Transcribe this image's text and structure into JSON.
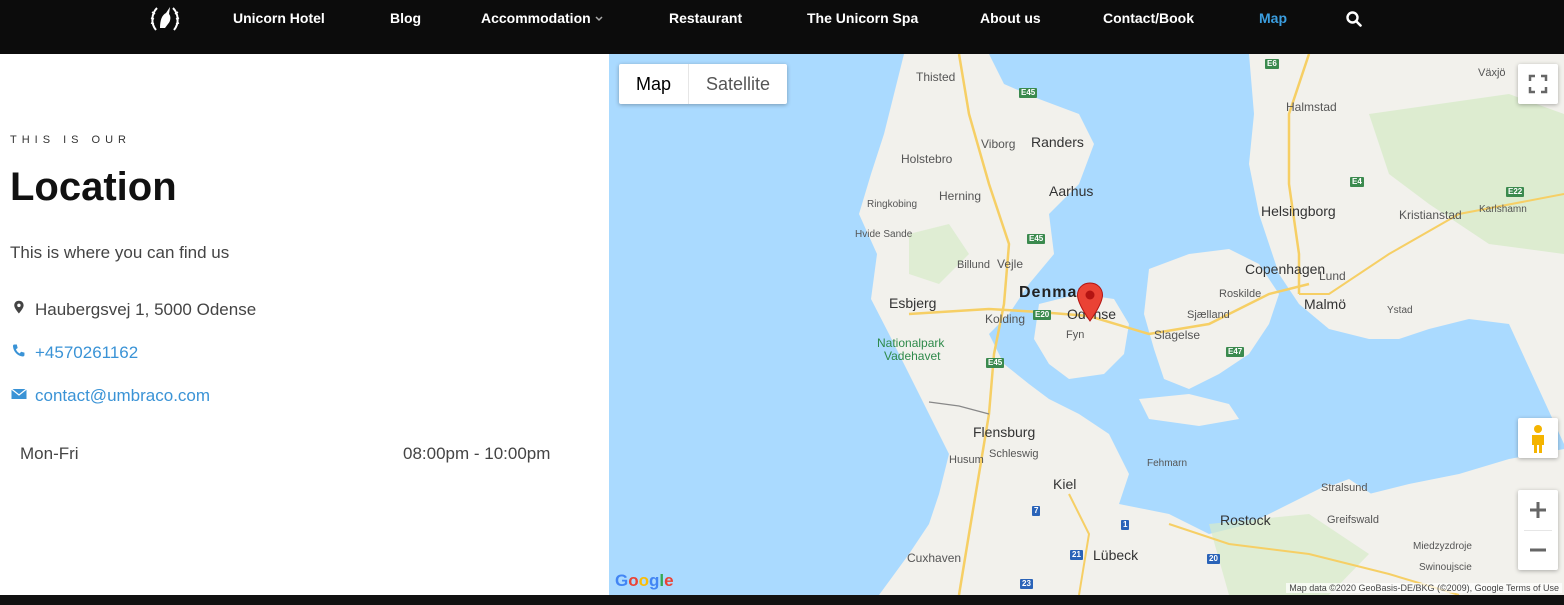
{
  "nav": {
    "items": [
      {
        "label": "Unicorn Hotel",
        "active": false
      },
      {
        "label": "Blog",
        "active": false
      },
      {
        "label": "Accommodation",
        "active": false,
        "has_dropdown": true
      },
      {
        "label": "Restaurant",
        "active": false
      },
      {
        "label": "The Unicorn Spa",
        "active": false
      },
      {
        "label": "About us",
        "active": false
      },
      {
        "label": "Contact/Book",
        "active": false
      },
      {
        "label": "Map",
        "active": true
      }
    ],
    "logo_icon": "unicorn-laurel-logo",
    "search_icon": "search-icon",
    "accent_color": "#3b9ee0"
  },
  "location": {
    "kicker": "THIS IS OUR",
    "title": "Location",
    "subtitle": "This is where you can find us",
    "address": "Haubergsvej 1, 5000 Odense",
    "phone": "+4570261162",
    "email": "contact@umbraco.com",
    "hours_day": "Mon-Fri",
    "hours_time": "08:00pm - 10:00pm",
    "link_color": "#3a93d6"
  },
  "map": {
    "type_map": "Map",
    "type_satellite": "Satellite",
    "selected_type": "Map",
    "places": {
      "thisted": "Thisted",
      "viborg": "Viborg",
      "randers": "Randers",
      "holstebro": "Holstebro",
      "herning": "Herning",
      "aarhus": "Aarhus",
      "ringkobing": "Ringkobing",
      "hvide_sande": "Hvide Sande",
      "billund": "Billund",
      "vejle": "Vejle",
      "esbjerg": "Esbjerg",
      "kolding": "Kolding",
      "denmark": "Denmark",
      "odense": "Odense",
      "fyn": "Fyn",
      "nationalpark": "Nationalpark",
      "vadehavet": "Vadehavet",
      "slagelse": "Slagelse",
      "sjaelland": "Sjælland",
      "roskilde": "Roskilde",
      "copenhagen": "Copenhagen",
      "lund": "Lund",
      "malmo": "Malmö",
      "ystad": "Ystad",
      "helsingborg": "Helsingborg",
      "kristianstad": "Kristianstad",
      "karlshamn": "Karlshamn",
      "halmstad": "Halmstad",
      "vaxjo": "Växjö",
      "flensburg": "Flensburg",
      "schleswig": "Schleswig",
      "husum": "Husum",
      "fehmarn": "Fehmarn",
      "kiel": "Kiel",
      "stralsund": "Stralsund",
      "rostock": "Rostock",
      "greifswald": "Greifswald",
      "lubeck": "Lübeck",
      "cuxhaven": "Cuxhaven",
      "miedzyzdroje": "Miedzyzdroje",
      "swinoujscie": "Swinoujscie"
    },
    "shields": [
      "E6",
      "E45",
      "E45",
      "E45",
      "E20",
      "E47",
      "E4",
      "E22",
      "7",
      "1",
      "21",
      "20",
      "23"
    ],
    "attribution": "Map data ©2020 GeoBasis-DE/BKG (©2009), Google   Terms of Use",
    "google_logo": "Google",
    "marker_icon": "red-map-pin-icon",
    "fullscreen_icon": "fullscreen-icon",
    "pegman_icon": "pegman-icon",
    "zoom_in_icon": "plus-icon",
    "zoom_out_icon": "minus-icon",
    "water_color": "#aadaff",
    "land_color": "#f2f1ec"
  }
}
